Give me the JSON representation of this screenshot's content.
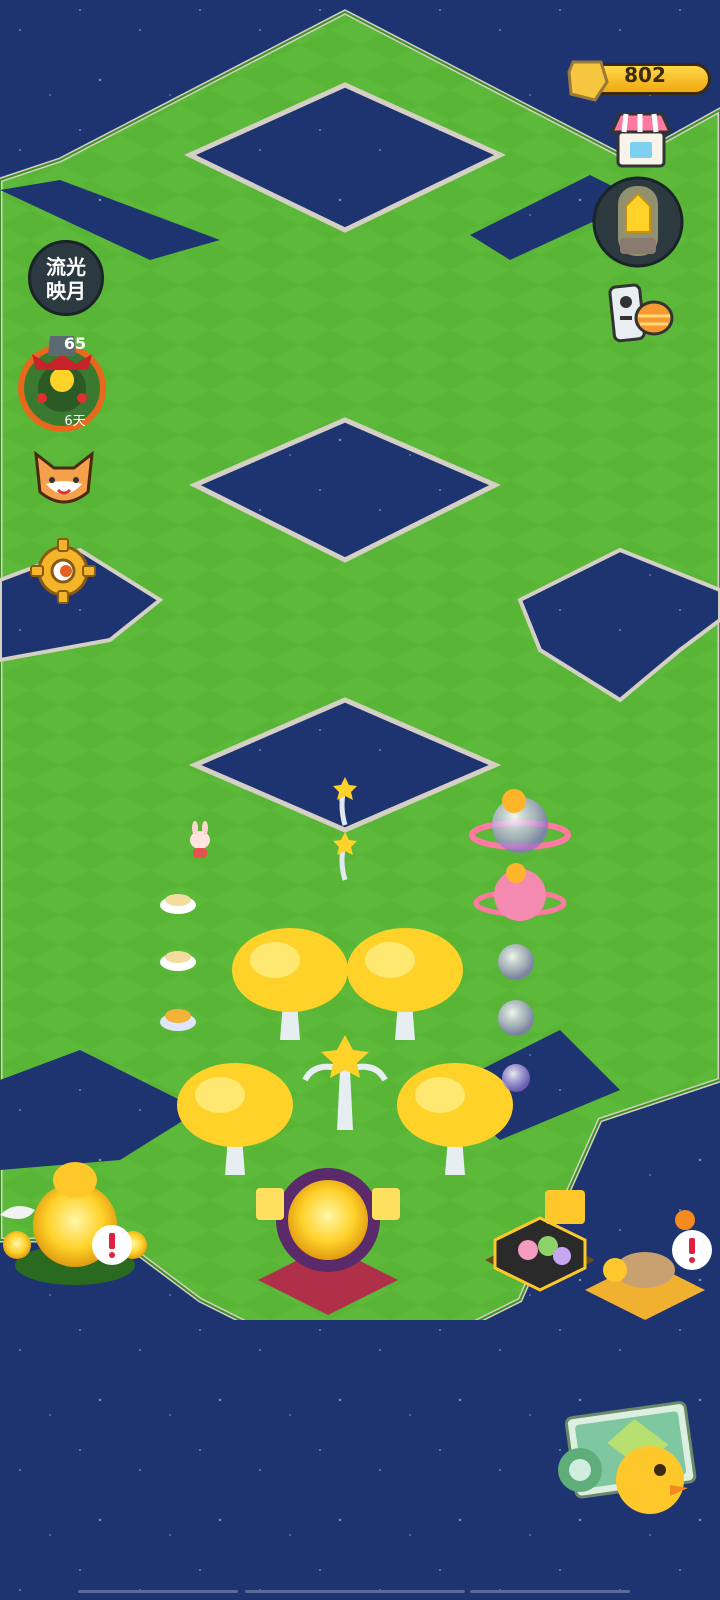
{
  "hud": {
    "coins": "802",
    "event_label_line1": "流光",
    "event_label_line2": "映月",
    "event_level": "65",
    "event_days": "6天"
  },
  "icons": {
    "coin": "moon-coin-icon",
    "shop": "shop-icon",
    "trophy": "golden-lamp-icon",
    "remote": "remote-control-icon",
    "event": "wreath-event-icon",
    "friends": "fox-face-icon",
    "settings": "gear-icon",
    "map": "map-camera-icon"
  },
  "colors": {
    "water": "#1e3470",
    "grass": "#5cb93a",
    "grass_dark": "#4ca32f",
    "coin_yellow": "#ffc82a",
    "alert": "#e02040"
  }
}
